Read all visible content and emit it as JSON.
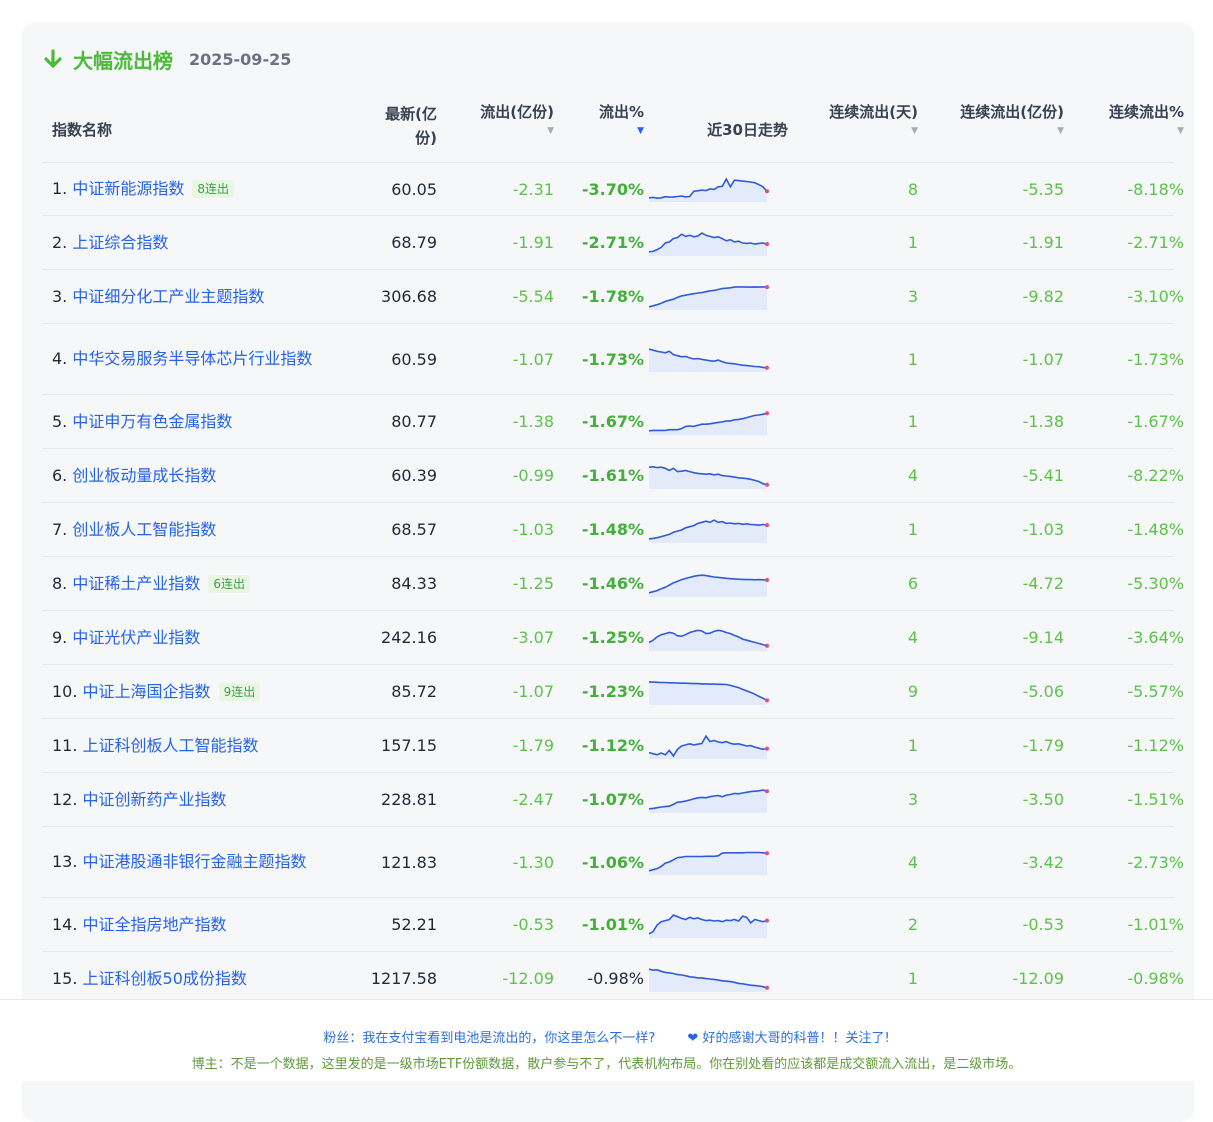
{
  "header": {
    "title": "大幅流出榜",
    "date": "2025-09-25",
    "accent": "#4cba3a"
  },
  "columns": {
    "name": "指数名称",
    "latest_line1": "最新(亿",
    "latest_line2": "份)",
    "outflow": "流出(亿份)",
    "outflow_pct": "流出%",
    "trend": "近30日走势",
    "streak_days": "连续流出(天)",
    "streak_outflow": "连续流出(亿份)",
    "streak_pct": "连续流出%",
    "sort_icon": "▼"
  },
  "rows": [
    {
      "idx": "1.",
      "name": "中证新能源指数",
      "badge": "8连出",
      "latest": "60.05",
      "outflow": "-2.31",
      "pct": "-3.70%",
      "days": "8",
      "cout": "-5.35",
      "cpct": "-8.18%",
      "spark": [
        0.1,
        0.12,
        0.08,
        0.1,
        0.15,
        0.13,
        0.14,
        0.16,
        0.18,
        0.14,
        0.16,
        0.4,
        0.42,
        0.45,
        0.43,
        0.5,
        0.48,
        0.6,
        0.62,
        0.95,
        0.6,
        0.9,
        0.88,
        0.86,
        0.84,
        0.82,
        0.78,
        0.7,
        0.6,
        0.4
      ]
    },
    {
      "idx": "2.",
      "name": "上证综合指数",
      "badge": "",
      "latest": "68.79",
      "outflow": "-1.91",
      "pct": "-2.71%",
      "days": "1",
      "cout": "-1.91",
      "cpct": "-2.71%",
      "spark": [
        0.1,
        0.12,
        0.2,
        0.3,
        0.5,
        0.55,
        0.7,
        0.75,
        0.9,
        0.8,
        0.85,
        0.78,
        0.82,
        0.95,
        0.85,
        0.8,
        0.75,
        0.78,
        0.7,
        0.6,
        0.65,
        0.55,
        0.58,
        0.5,
        0.48,
        0.5,
        0.45,
        0.48,
        0.5,
        0.45
      ]
    },
    {
      "idx": "3.",
      "name": "中证细分化工产业主题指数",
      "badge": "",
      "latest": "306.68",
      "outflow": "-5.54",
      "pct": "-1.78%",
      "days": "3",
      "cout": "-9.82",
      "cpct": "-3.10%",
      "spark": [
        0.05,
        0.1,
        0.15,
        0.22,
        0.3,
        0.35,
        0.4,
        0.48,
        0.55,
        0.58,
        0.62,
        0.65,
        0.68,
        0.7,
        0.74,
        0.78,
        0.8,
        0.84,
        0.88,
        0.9,
        0.92,
        0.95,
        0.96,
        0.96,
        0.95,
        0.95,
        0.96,
        0.95,
        0.96,
        0.95
      ]
    },
    {
      "idx": "4.",
      "name": "中华交易服务半导体芯片行业指数",
      "badge": "",
      "latest": "60.59",
      "outflow": "-1.07",
      "pct": "-1.73%",
      "days": "1",
      "cout": "-1.07",
      "cpct": "-1.73%",
      "spark": [
        0.95,
        0.9,
        0.85,
        0.82,
        0.78,
        0.85,
        0.7,
        0.65,
        0.6,
        0.62,
        0.55,
        0.5,
        0.52,
        0.48,
        0.45,
        0.42,
        0.4,
        0.45,
        0.38,
        0.32,
        0.3,
        0.28,
        0.25,
        0.22,
        0.2,
        0.18,
        0.16,
        0.15,
        0.12,
        0.1
      ]
    },
    {
      "idx": "5.",
      "name": "中证申万有色金属指数",
      "badge": "",
      "latest": "80.77",
      "outflow": "-1.38",
      "pct": "-1.67%",
      "days": "1",
      "cout": "-1.38",
      "cpct": "-1.67%",
      "spark": [
        0.1,
        0.12,
        0.12,
        0.12,
        0.12,
        0.15,
        0.15,
        0.15,
        0.2,
        0.3,
        0.32,
        0.3,
        0.35,
        0.4,
        0.4,
        0.42,
        0.45,
        0.48,
        0.5,
        0.55,
        0.55,
        0.6,
        0.62,
        0.65,
        0.7,
        0.75,
        0.8,
        0.82,
        0.85,
        0.9
      ]
    },
    {
      "idx": "6.",
      "name": "创业板动量成长指数",
      "badge": "",
      "latest": "60.39",
      "outflow": "-0.99",
      "pct": "-1.61%",
      "days": "4",
      "cout": "-5.41",
      "cpct": "-8.22%",
      "spark": [
        0.9,
        0.92,
        0.88,
        0.9,
        0.85,
        0.75,
        0.85,
        0.7,
        0.72,
        0.75,
        0.7,
        0.65,
        0.62,
        0.6,
        0.58,
        0.6,
        0.55,
        0.58,
        0.52,
        0.5,
        0.48,
        0.45,
        0.42,
        0.4,
        0.38,
        0.35,
        0.3,
        0.25,
        0.15,
        0.1
      ]
    },
    {
      "idx": "7.",
      "name": "创业板人工智能指数",
      "badge": "",
      "latest": "68.57",
      "outflow": "-1.03",
      "pct": "-1.48%",
      "days": "1",
      "cout": "-1.03",
      "cpct": "-1.48%",
      "spark": [
        0.1,
        0.12,
        0.15,
        0.2,
        0.25,
        0.3,
        0.4,
        0.45,
        0.5,
        0.6,
        0.65,
        0.7,
        0.8,
        0.85,
        0.9,
        0.85,
        0.95,
        0.85,
        0.88,
        0.8,
        0.82,
        0.78,
        0.8,
        0.76,
        0.78,
        0.75,
        0.74,
        0.72,
        0.75,
        0.72
      ]
    },
    {
      "idx": "8.",
      "name": "中证稀土产业指数",
      "badge": "6连出",
      "latest": "84.33",
      "outflow": "-1.25",
      "pct": "-1.46%",
      "days": "6",
      "cout": "-4.72",
      "cpct": "-5.30%",
      "spark": [
        0.1,
        0.15,
        0.2,
        0.28,
        0.35,
        0.45,
        0.55,
        0.62,
        0.7,
        0.75,
        0.8,
        0.85,
        0.88,
        0.9,
        0.88,
        0.85,
        0.82,
        0.8,
        0.78,
        0.76,
        0.74,
        0.73,
        0.72,
        0.71,
        0.7,
        0.7,
        0.69,
        0.7,
        0.69,
        0.68
      ]
    },
    {
      "idx": "9.",
      "name": "中证光伏产业指数",
      "badge": "",
      "latest": "242.16",
      "outflow": "-3.07",
      "pct": "-1.25%",
      "days": "4",
      "cout": "-9.14",
      "cpct": "-3.64%",
      "spark": [
        0.3,
        0.4,
        0.55,
        0.65,
        0.7,
        0.75,
        0.72,
        0.6,
        0.58,
        0.65,
        0.75,
        0.8,
        0.85,
        0.82,
        0.7,
        0.72,
        0.8,
        0.85,
        0.82,
        0.75,
        0.7,
        0.62,
        0.55,
        0.45,
        0.4,
        0.35,
        0.3,
        0.25,
        0.2,
        0.15
      ]
    },
    {
      "idx": "10.",
      "name": "中证上海国企指数",
      "badge": "9连出",
      "latest": "85.72",
      "outflow": "-1.07",
      "pct": "-1.23%",
      "days": "9",
      "cout": "-5.06",
      "cpct": "-5.57%",
      "spark": [
        0.95,
        0.95,
        0.94,
        0.93,
        0.93,
        0.92,
        0.92,
        0.91,
        0.9,
        0.9,
        0.89,
        0.88,
        0.88,
        0.87,
        0.87,
        0.86,
        0.86,
        0.85,
        0.85,
        0.84,
        0.8,
        0.75,
        0.7,
        0.62,
        0.55,
        0.48,
        0.4,
        0.3,
        0.22,
        0.12
      ]
    },
    {
      "idx": "11.",
      "name": "上证科创板人工智能指数",
      "badge": "",
      "latest": "157.15",
      "outflow": "-1.79",
      "pct": "-1.12%",
      "days": "1",
      "cout": "-1.79",
      "cpct": "-1.12%",
      "spark": [
        0.2,
        0.15,
        0.1,
        0.18,
        0.1,
        0.3,
        0.05,
        0.35,
        0.5,
        0.55,
        0.6,
        0.55,
        0.58,
        0.62,
        0.95,
        0.7,
        0.75,
        0.68,
        0.65,
        0.7,
        0.62,
        0.58,
        0.6,
        0.55,
        0.5,
        0.52,
        0.45,
        0.4,
        0.35,
        0.38
      ]
    },
    {
      "idx": "12.",
      "name": "中证创新药产业指数",
      "badge": "",
      "latest": "228.81",
      "outflow": "-2.47",
      "pct": "-1.07%",
      "days": "3",
      "cout": "-3.50",
      "cpct": "-1.51%",
      "spark": [
        0.1,
        0.12,
        0.15,
        0.18,
        0.2,
        0.22,
        0.3,
        0.4,
        0.42,
        0.45,
        0.5,
        0.55,
        0.6,
        0.62,
        0.6,
        0.65,
        0.68,
        0.7,
        0.65,
        0.72,
        0.75,
        0.8,
        0.78,
        0.82,
        0.85,
        0.88,
        0.9,
        0.92,
        0.95,
        0.9
      ]
    },
    {
      "idx": "13.",
      "name": "中证港股通非银行金融主题指数",
      "badge": "",
      "latest": "121.83",
      "outflow": "-1.30",
      "pct": "-1.06%",
      "days": "4",
      "cout": "-3.42",
      "cpct": "-2.73%",
      "spark": [
        0.1,
        0.15,
        0.2,
        0.3,
        0.45,
        0.5,
        0.6,
        0.7,
        0.72,
        0.75,
        0.75,
        0.75,
        0.75,
        0.75,
        0.76,
        0.76,
        0.76,
        0.78,
        0.9,
        0.92,
        0.92,
        0.92,
        0.92,
        0.92,
        0.93,
        0.93,
        0.93,
        0.93,
        0.92,
        0.9
      ]
    },
    {
      "idx": "14.",
      "name": "中证全指房地产指数",
      "badge": "",
      "latest": "52.21",
      "outflow": "-0.53",
      "pct": "-1.01%",
      "days": "2",
      "cout": "-0.53",
      "cpct": "-1.01%",
      "spark": [
        0.1,
        0.2,
        0.5,
        0.65,
        0.7,
        0.75,
        0.95,
        0.88,
        0.8,
        0.75,
        0.85,
        0.78,
        0.82,
        0.75,
        0.7,
        0.72,
        0.68,
        0.7,
        0.65,
        0.72,
        0.7,
        0.75,
        0.68,
        0.9,
        0.85,
        0.6,
        0.75,
        0.7,
        0.65,
        0.7
      ]
    },
    {
      "idx": "15.",
      "name": "上证科创板50成份指数",
      "badge": "",
      "latest": "1217.58",
      "outflow": "-12.09",
      "pct": "-0.98%",
      "days": "1",
      "cout": "-12.09",
      "cpct": "-0.98%",
      "spark": [
        0.95,
        0.9,
        0.92,
        0.85,
        0.8,
        0.78,
        0.75,
        0.7,
        0.68,
        0.65,
        0.6,
        0.58,
        0.55,
        0.55,
        0.52,
        0.5,
        0.48,
        0.45,
        0.42,
        0.4,
        0.38,
        0.35,
        0.3,
        0.28,
        0.25,
        0.22,
        0.2,
        0.18,
        0.15,
        0.1
      ]
    }
  ],
  "footer": {
    "line1": "粉丝：我在支付宝看到电池是流出的，你这里怎么不一样?",
    "heart": "❤",
    "line1b": "好的感谢大哥的科普！！关注了!",
    "line2": "博主：不是一个数据，这里发的是一级市场ETF份额数据，散户参与不了，代表机构布局。你在别处看的应该都是成交额流入流出，是二级市场。"
  },
  "colors": {
    "up_green": "#5cc24a",
    "link_blue": "#2563eb",
    "spark_line": "#2f5bd8",
    "spark_end": "#e74c6a"
  }
}
